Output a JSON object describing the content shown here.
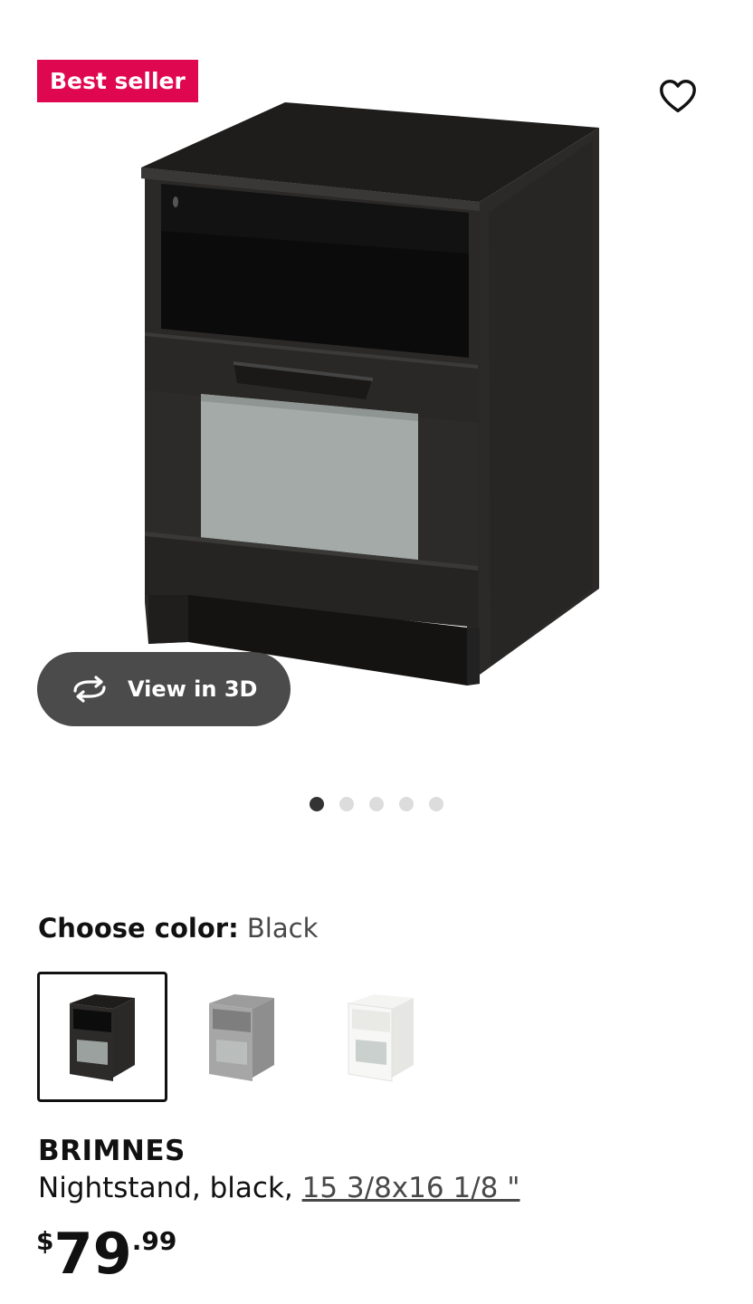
{
  "badge": {
    "label": "Best seller",
    "color": "#e00751"
  },
  "favorite": {
    "icon": "heart-outline-icon"
  },
  "view3d": {
    "label": "View in 3D",
    "icon": "rotate-3d-icon"
  },
  "carousel": {
    "count": 5,
    "active_index": 0
  },
  "color_picker": {
    "label": "Choose color:",
    "selected": "Black",
    "options": [
      {
        "name": "black",
        "color": "#2a2a2a",
        "selected": true
      },
      {
        "name": "gray",
        "color": "#9a9a9a",
        "selected": false
      },
      {
        "name": "white",
        "color": "#f2f2ee",
        "selected": false
      }
    ]
  },
  "product": {
    "name": "BRIMNES",
    "description": "Nightstand, black, ",
    "measurement": "15 3/8x16 1/8 \"",
    "price_currency": "$",
    "price_integer": "79",
    "price_decimal": ".99"
  }
}
